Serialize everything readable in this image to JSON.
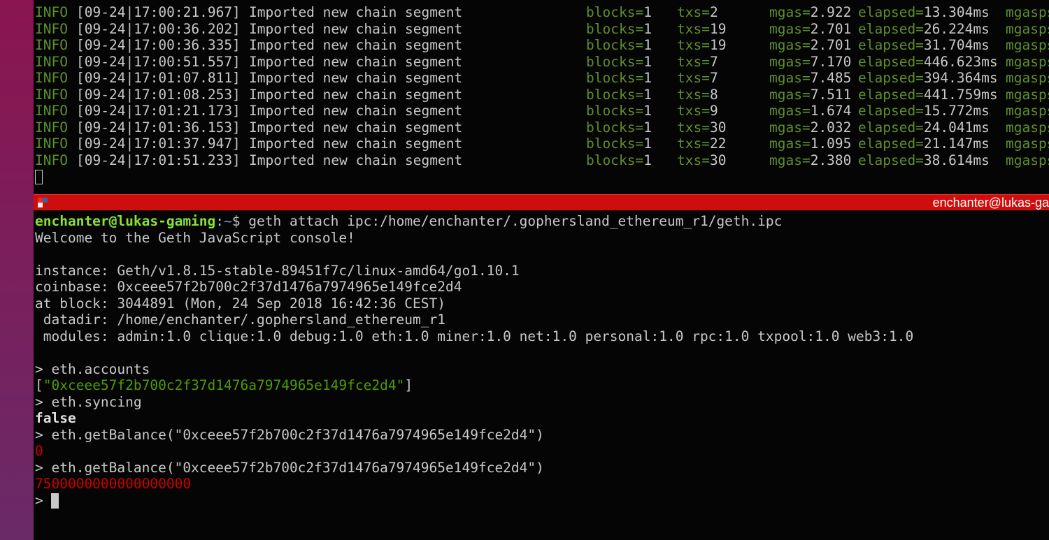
{
  "colors": {
    "titlebar": "#d00d0d",
    "info": "#5e8f2c",
    "prompt_user": "#8ae234",
    "prompt_path": "#729fcf",
    "string": "#4e9a06",
    "number": "#cc0000"
  },
  "top_pane": {
    "log_lines": [
      {
        "level": "INFO",
        "time": "[09-24|17:00:21.967]",
        "msg": "Imported new chain segment",
        "blocks": "1",
        "txs": "2",
        "mgas": "2.922",
        "elapsed": "13.304ms",
        "mgasps": "mgasps"
      },
      {
        "level": "INFO",
        "time": "[09-24|17:00:36.202]",
        "msg": "Imported new chain segment",
        "blocks": "1",
        "txs": "19",
        "mgas": "2.701",
        "elapsed": "26.224ms",
        "mgasps": "mgasps"
      },
      {
        "level": "INFO",
        "time": "[09-24|17:00:36.335]",
        "msg": "Imported new chain segment",
        "blocks": "1",
        "txs": "19",
        "mgas": "2.701",
        "elapsed": "31.704ms",
        "mgasps": "mgasps"
      },
      {
        "level": "INFO",
        "time": "[09-24|17:00:51.557]",
        "msg": "Imported new chain segment",
        "blocks": "1",
        "txs": "7",
        "mgas": "7.170",
        "elapsed": "446.623ms",
        "mgasps": "mgasps"
      },
      {
        "level": "INFO",
        "time": "[09-24|17:01:07.811]",
        "msg": "Imported new chain segment",
        "blocks": "1",
        "txs": "7",
        "mgas": "7.485",
        "elapsed": "394.364ms",
        "mgasps": "mgasps"
      },
      {
        "level": "INFO",
        "time": "[09-24|17:01:08.253]",
        "msg": "Imported new chain segment",
        "blocks": "1",
        "txs": "8",
        "mgas": "7.511",
        "elapsed": "441.759ms",
        "mgasps": "mgasps"
      },
      {
        "level": "INFO",
        "time": "[09-24|17:01:21.173]",
        "msg": "Imported new chain segment",
        "blocks": "1",
        "txs": "9",
        "mgas": "1.674",
        "elapsed": "15.772ms",
        "mgasps": "mgasps"
      },
      {
        "level": "INFO",
        "time": "[09-24|17:01:36.153]",
        "msg": "Imported new chain segment",
        "blocks": "1",
        "txs": "30",
        "mgas": "2.032",
        "elapsed": "24.041ms",
        "mgasps": "mgasps"
      },
      {
        "level": "INFO",
        "time": "[09-24|17:01:37.947]",
        "msg": "Imported new chain segment",
        "blocks": "1",
        "txs": "22",
        "mgas": "1.095",
        "elapsed": "21.147ms",
        "mgasps": "mgasps"
      },
      {
        "level": "INFO",
        "time": "[09-24|17:01:51.233]",
        "msg": "Imported new chain segment",
        "blocks": "1",
        "txs": "30",
        "mgas": "2.380",
        "elapsed": "38.614ms",
        "mgasps": "mgasps"
      }
    ]
  },
  "titlebar": {
    "title": "enchanter@lukas-ga"
  },
  "bottom_pane": {
    "lines": [
      [
        {
          "t": "enchanter@lukas-gaming",
          "c": "u"
        },
        {
          "t": ":",
          "c": "w"
        },
        {
          "t": "~",
          "c": "b"
        },
        {
          "t": "$ geth attach ipc:/home/enchanter/.gophersland_ethereum_r1/geth.ipc",
          "c": "w"
        }
      ],
      [
        {
          "t": "Welcome to the Geth JavaScript console!",
          "c": "w"
        }
      ],
      [],
      [
        {
          "t": "instance: Geth/v1.8.15-stable-89451f7c/linux-amd64/go1.10.1",
          "c": "w"
        }
      ],
      [
        {
          "t": "coinbase: 0xceee57f2b700c2f37d1476a7974965e149fce2d4",
          "c": "w"
        }
      ],
      [
        {
          "t": "at block: 3044891 (Mon, 24 Sep 2018 16:42:36 CEST)",
          "c": "w"
        }
      ],
      [
        {
          "t": " datadir: /home/enchanter/.gophersland_ethereum_r1",
          "c": "w"
        }
      ],
      [
        {
          "t": " modules: admin:1.0 clique:1.0 debug:1.0 eth:1.0 miner:1.0 net:1.0 personal:1.0 rpc:1.0 txpool:1.0 web3:1.0",
          "c": "w"
        }
      ],
      [],
      [
        {
          "t": "> eth.accounts",
          "c": "w"
        }
      ],
      [
        {
          "t": "[",
          "c": "w"
        },
        {
          "t": "\"0xceee57f2b700c2f37d1476a7974965e149fce2d4\"",
          "c": "s"
        },
        {
          "t": "]",
          "c": "w"
        }
      ],
      [
        {
          "t": "> eth.syncing",
          "c": "w"
        }
      ],
      [
        {
          "t": "false",
          "c": "bold"
        }
      ],
      [
        {
          "t": "> eth.getBalance(\"0xceee57f2b700c2f37d1476a7974965e149fce2d4\")",
          "c": "w"
        }
      ],
      [
        {
          "t": "0",
          "c": "r"
        }
      ],
      [
        {
          "t": "> eth.getBalance(\"0xceee57f2b700c2f37d1476a7974965e149fce2d4\")",
          "c": "w"
        }
      ],
      [
        {
          "t": "7500000000000000000",
          "c": "r"
        }
      ],
      [
        {
          "t": "> ",
          "c": "w"
        }
      ]
    ]
  }
}
